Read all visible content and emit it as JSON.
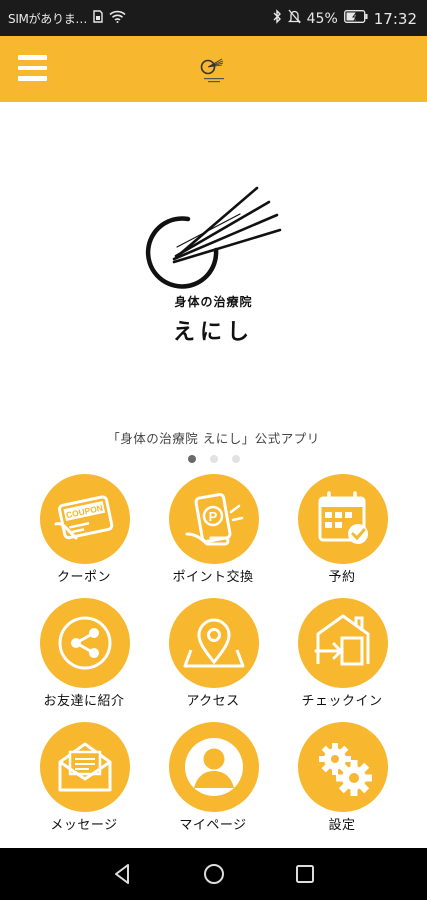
{
  "status_bar": {
    "carrier": "SIMがありま…",
    "battery_percent": "45%",
    "time": "17:32",
    "icons": [
      "sim-icon",
      "wifi-icon",
      "bluetooth-icon",
      "mute-icon",
      "battery-icon"
    ]
  },
  "header": {
    "menu_icon": "hamburger-menu-icon",
    "logo": "enishi-logo"
  },
  "hero": {
    "brand_sub": "身体の治療院",
    "brand_main": "えにし",
    "caption": "「身体の治療院 えにし」公式アプリ",
    "pager": {
      "count": 3,
      "active": 0
    }
  },
  "menu": [
    {
      "label": "クーポン",
      "icon": "coupon-icon"
    },
    {
      "label": "ポイント交換",
      "icon": "point-card-icon"
    },
    {
      "label": "予約",
      "icon": "calendar-check-icon"
    },
    {
      "label": "お友達に紹介",
      "icon": "share-icon"
    },
    {
      "label": "アクセス",
      "icon": "map-pin-icon"
    },
    {
      "label": "チェックイン",
      "icon": "checkin-door-icon"
    },
    {
      "label": "メッセージ",
      "icon": "envelope-icon"
    },
    {
      "label": "マイページ",
      "icon": "user-icon"
    },
    {
      "label": "設定",
      "icon": "gears-icon"
    }
  ],
  "colors": {
    "accent": "#f7b72e",
    "status_bar": "#1b1b1b",
    "nav_bar": "#000000"
  },
  "nav_bar": {
    "icons": [
      "back-icon",
      "home-icon",
      "recents-icon"
    ]
  }
}
